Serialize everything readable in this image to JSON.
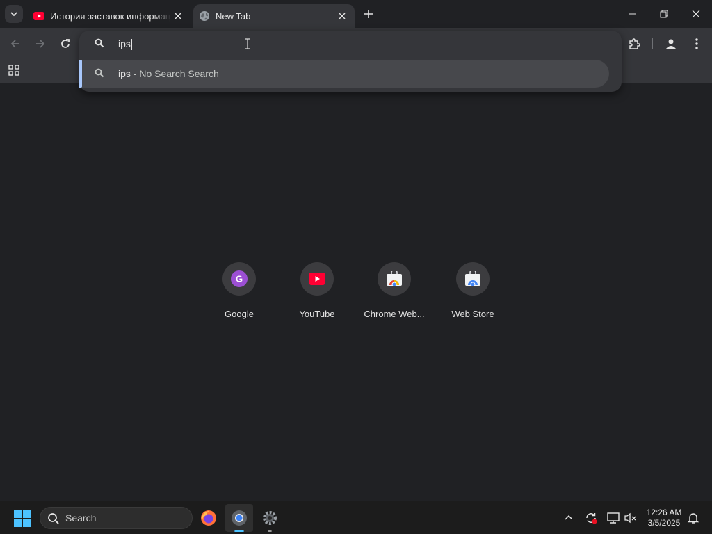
{
  "tabs": [
    {
      "title": "История заставок информационных",
      "favicon": "youtube-icon",
      "active": false
    },
    {
      "title": "New Tab",
      "favicon": "globe-icon",
      "active": true
    }
  ],
  "omnibox": {
    "value": "ips",
    "suggestion_query": "ips",
    "suggestion_sep": " - ",
    "suggestion_provider": "No Search Search"
  },
  "shortcuts": [
    {
      "label": "Google",
      "icon": "google-letter-icon",
      "letter": "G"
    },
    {
      "label": "YouTube",
      "icon": "youtube-icon"
    },
    {
      "label": "Chrome Web...",
      "icon": "chrome-web-store-icon"
    },
    {
      "label": "Web Store",
      "icon": "chrome-web-store-icon"
    }
  ],
  "taskbar": {
    "search_label": "Search",
    "time": "12:26 AM",
    "date": "3/5/2025"
  },
  "colors": {
    "accent": "#a8c7fa",
    "background": "#202124",
    "surface": "#35363a",
    "youtube_red": "#ff0033",
    "google_purple": "#9c4fd4"
  }
}
